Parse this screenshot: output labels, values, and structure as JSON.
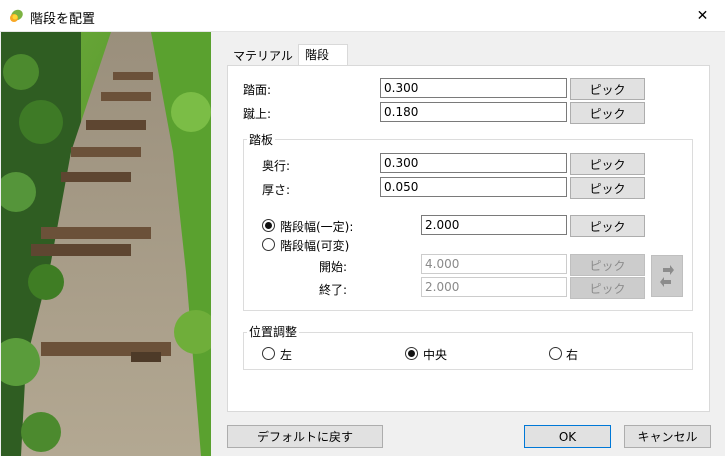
{
  "window": {
    "title": "階段を配置",
    "app_icon": "leaf-app-icon",
    "close_glyph": "✕"
  },
  "tabs": [
    {
      "label": "マテリアル",
      "active": false
    },
    {
      "label": "階段",
      "active": true
    }
  ],
  "tread": {
    "label": "踏面:",
    "value": "0.300"
  },
  "riser": {
    "label": "蹴上:",
    "value": "0.180"
  },
  "board": {
    "title": "踏板",
    "depth": {
      "label": "奥行:",
      "value": "0.300"
    },
    "thickness": {
      "label": "厚さ:",
      "value": "0.050"
    }
  },
  "width": {
    "fixed": {
      "label": "階段幅(一定):",
      "value": "2.000",
      "checked": true
    },
    "variable": {
      "label": "階段幅(可変)",
      "checked": false
    },
    "start": {
      "label": "開始:",
      "value": "4.000"
    },
    "end": {
      "label": "終了:",
      "value": "2.000"
    }
  },
  "pick_label": "ピック",
  "position": {
    "title": "位置調整",
    "options": [
      {
        "label": "左",
        "checked": false
      },
      {
        "label": "中央",
        "checked": true
      },
      {
        "label": "右",
        "checked": false
      }
    ]
  },
  "footer": {
    "default_label": "デフォルトに戻す",
    "ok_label": "OK",
    "cancel_label": "キャンセル"
  },
  "colors": {
    "accent": "#0078d7",
    "window_bg": "#f0f0f0"
  }
}
